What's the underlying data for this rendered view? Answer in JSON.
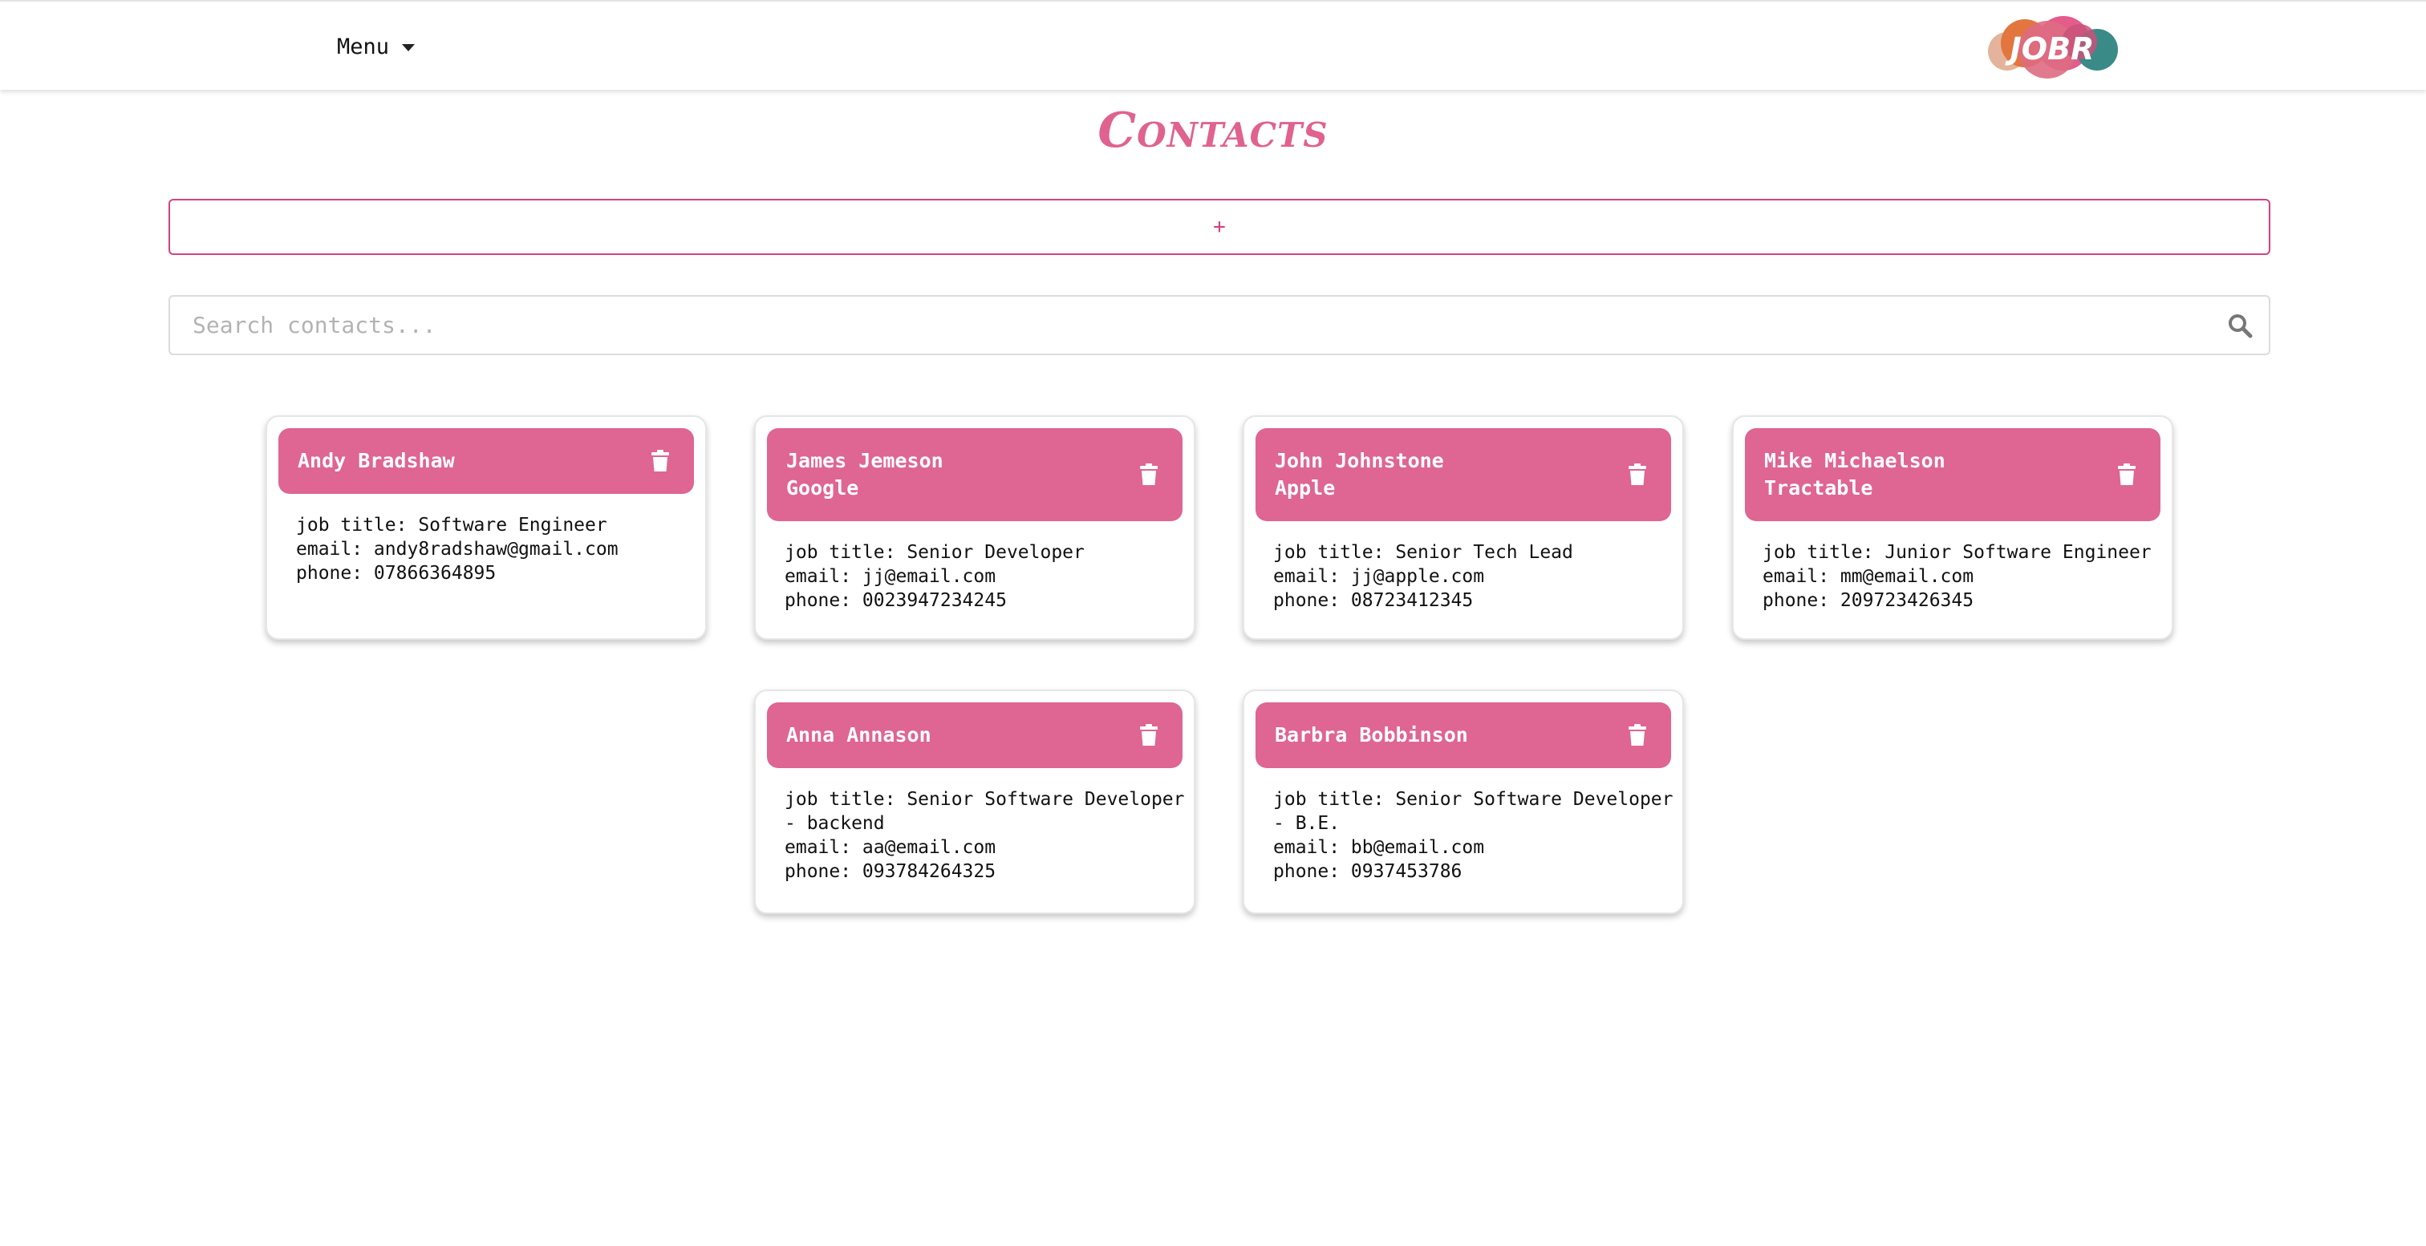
{
  "nav": {
    "menu_label": "Menu",
    "logo_text": "JOBR"
  },
  "page": {
    "title": "Contacts",
    "add_label": "+",
    "search_placeholder": "Search contacts..."
  },
  "contacts": [
    {
      "name": "Andy Bradshaw",
      "company": "",
      "job_title": "job title: Software Engineer",
      "email": "email: andy8radshaw@gmail.com",
      "phone": "phone: 07866364895"
    },
    {
      "name": "James Jemeson",
      "company": "Google",
      "job_title": "job title: Senior Developer",
      "email": "email: jj@email.com",
      "phone": "phone: 0023947234245"
    },
    {
      "name": "John Johnstone",
      "company": "Apple",
      "job_title": "job title: Senior Tech Lead",
      "email": "email: jj@apple.com",
      "phone": "phone: 08723412345"
    },
    {
      "name": "Mike Michaelson",
      "company": "Tractable",
      "job_title": "job title: Junior Software Engineer",
      "email": "email: mm@email.com",
      "phone": "phone: 209723426345"
    },
    {
      "name": "Anna Annason",
      "company": "",
      "job_title": "job title: Senior Software Developer\n- backend",
      "email": "email: aa@email.com",
      "phone": "phone: 093784264325"
    },
    {
      "name": "Barbra Bobbinson",
      "company": "",
      "job_title": "job title: Senior Software Developer\n- B.E.",
      "email": "email: bb@email.com",
      "phone": "phone: 0937453786"
    }
  ],
  "colors": {
    "accent": "#df6592",
    "accent_border": "#d6417e"
  },
  "icons": {
    "menu_caret": "chevron-down-icon",
    "search": "search-icon",
    "delete": "trash-icon"
  }
}
